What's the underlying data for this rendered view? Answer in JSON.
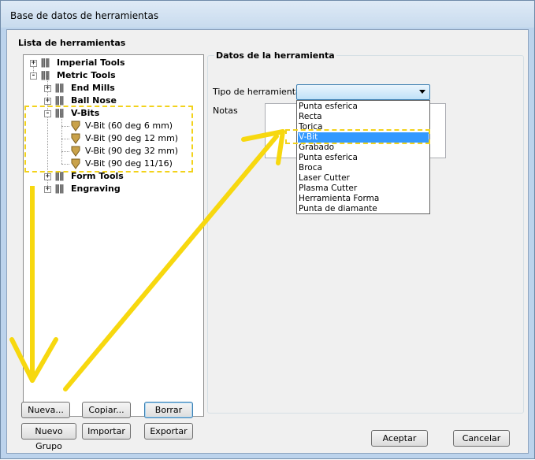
{
  "window": {
    "title": "Base de datos de herramientas"
  },
  "tool_list": {
    "label": "Lista de herramientas",
    "items": [
      {
        "label": "Imperial Tools",
        "expander": "+"
      },
      {
        "label": "Metric Tools",
        "expander": "-"
      },
      {
        "label": "End Mills",
        "expander": "+"
      },
      {
        "label": "Ball Nose",
        "expander": "+"
      },
      {
        "label": "V-Bits",
        "expander": "-"
      },
      {
        "label": "V-Bit (60 deg 6 mm)"
      },
      {
        "label": "V-Bit (90 deg 12 mm)"
      },
      {
        "label": "V-Bit (90 deg 32 mm)"
      },
      {
        "label": "V-Bit (90 deg 11/16)"
      },
      {
        "label": "Form Tools",
        "expander": "+"
      },
      {
        "label": "Engraving",
        "expander": "+"
      }
    ]
  },
  "buttons": {
    "nueva": "Nueva...",
    "copiar": "Copiar...",
    "borrar": "Borrar",
    "nuevo_grupo": "Nuevo Grupo",
    "importar": "Importar",
    "exportar": "Exportar",
    "aceptar": "Aceptar",
    "cancelar": "Cancelar"
  },
  "tool_data": {
    "label": "Datos de la herramienta",
    "tipo_label": "Tipo de herramienta",
    "notas_label": "Notas",
    "tipo_value": "",
    "options": [
      {
        "label": "Punta esferica",
        "selected": false
      },
      {
        "label": "Recta",
        "selected": false
      },
      {
        "label": "Torica",
        "selected": false
      },
      {
        "label": "V-Bit",
        "selected": true
      },
      {
        "label": "Grabado",
        "selected": false
      },
      {
        "label": "Punta esferica",
        "selected": false
      },
      {
        "label": "Broca",
        "selected": false
      },
      {
        "label": "Laser Cutter",
        "selected": false
      },
      {
        "label": "Plasma Cutter",
        "selected": false
      },
      {
        "label": "Herramienta Forma",
        "selected": false
      },
      {
        "label": "Punta de diamante",
        "selected": false
      }
    ]
  },
  "colors": {
    "annotation_yellow": "#f7d80f",
    "selection_blue": "#3399ff",
    "window_frame": "#bcd3ec"
  }
}
